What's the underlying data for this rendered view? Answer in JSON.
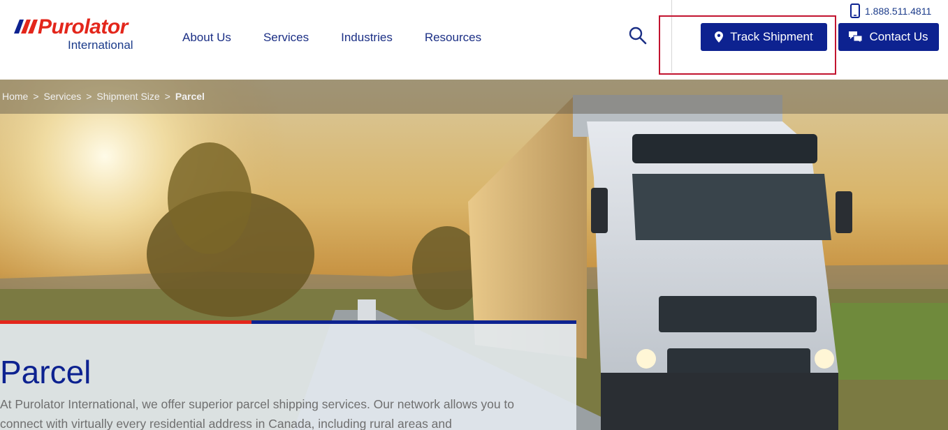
{
  "header": {
    "logo": {
      "brand": "Purolator",
      "sub": "International"
    },
    "nav": [
      "About Us",
      "Services",
      "Industries",
      "Resources"
    ],
    "phone": "1.888.511.4811",
    "buttons": {
      "track": "Track Shipment",
      "contact": "Contact Us"
    }
  },
  "breadcrumb": {
    "items": [
      "Home",
      "Services",
      "Shipment Size"
    ],
    "current": "Parcel",
    "separator": ">"
  },
  "hero": {
    "title": "Parcel",
    "intro": "At Purolator International, we offer superior parcel shipping services. Our network allows you to connect with virtually every residential address in Canada, including rural areas and"
  },
  "colors": {
    "brand_blue": "#0d2290",
    "brand_red": "#e3261b",
    "highlight": "#c2142f"
  },
  "icons": [
    "search-icon",
    "phone-icon",
    "location-pin-icon",
    "chat-icon"
  ]
}
